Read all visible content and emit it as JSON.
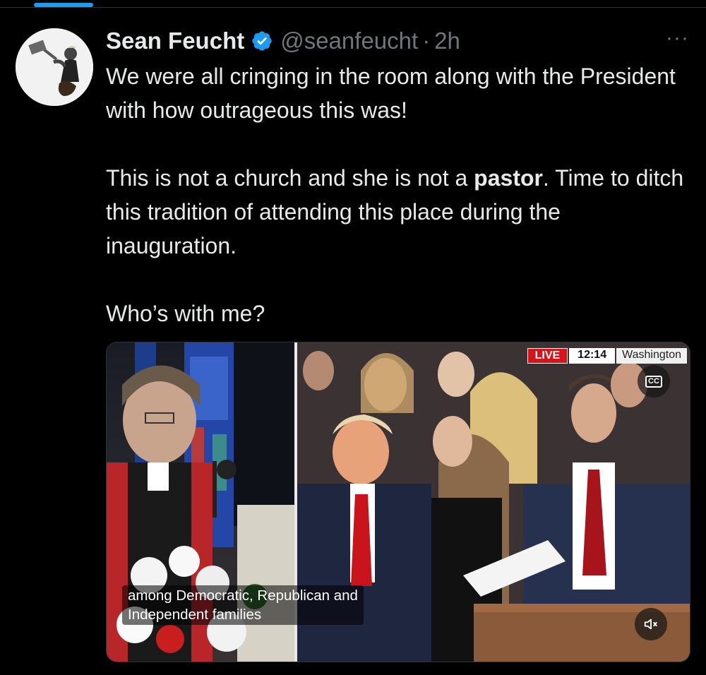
{
  "author": {
    "display_name": "Sean Feucht",
    "handle": "@seanfeucht",
    "separator": "·",
    "time": "2h",
    "verified": true,
    "avatar_icon": "avatar-photo"
  },
  "more_icon": "···",
  "tweet": {
    "line1": "We were all cringing in the room along with the President with how outrageous this was!",
    "line2_before": "This is not a church and she is not a ",
    "line2_bold": "pastor",
    "line2_after": ". Time to ditch this tradition of attending this place during the inauguration.",
    "line3": "Who’s with me?"
  },
  "media": {
    "live_label": "LIVE",
    "live_time": "12:14",
    "live_location": "Washington",
    "cc_label": "CC",
    "caption": "among Democratic, Republican and\nIndependent families",
    "mute_icon": "mute-icon"
  },
  "colors": {
    "accent": "#1d9bf0",
    "background": "#000000",
    "text": "#e7e9ea",
    "muted": "#71767b",
    "live_red": "#d7141a"
  }
}
